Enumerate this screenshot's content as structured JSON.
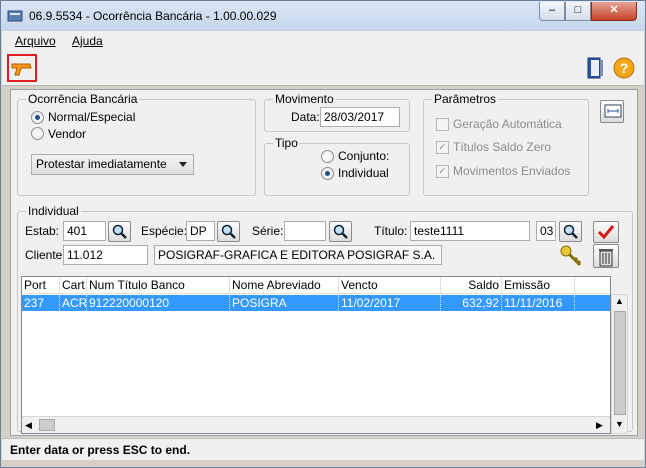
{
  "window": {
    "title": "06.9.5534 - Ocorrência Bancária - 1.00.00.029",
    "minimize": "–",
    "maximize": "□",
    "close": "✕"
  },
  "menu": [
    {
      "label": "Arquivo"
    },
    {
      "label": "Ajuda"
    }
  ],
  "ocorrencia": {
    "legend": "Ocorrência Bancária",
    "option_normal": "Normal/Especial",
    "option_vendor": "Vendor",
    "select_value": "Protestar imediatamente"
  },
  "movimento": {
    "legend": "Movimento",
    "data_label": "Data:",
    "data_value": "28/03/2017"
  },
  "tipo": {
    "legend": "Tipo",
    "option_conjunto": "Conjunto:",
    "option_individual": "Individual"
  },
  "parametros": {
    "legend": "Parâmetros",
    "geracao": "Geração Automática",
    "titulos_zero": "Títulos Saldo Zero",
    "movimentos": "Movimentos Enviados"
  },
  "individual": {
    "legend": "Individual",
    "estab_label": "Estab:",
    "estab_value": "401",
    "especie_label": "Espécie:",
    "especie_value": "DP",
    "serie_label": "Série:",
    "serie_value": "",
    "titulo_label": "Título:",
    "titulo_value": "teste1111",
    "parcela_value": "03",
    "cliente_label": "Cliente:",
    "cliente_value": "11.012",
    "cliente_nome": "POSIGRAF-GRAFICA E EDITORA POSIGRAF S.A."
  },
  "grid": {
    "columns": [
      "Port",
      "Cart",
      "Num Título Banco",
      "Nome Abreviado",
      "Vencto",
      "Saldo",
      "Emissão"
    ],
    "rows": [
      [
        "237",
        "ACR",
        "912220000120",
        "POSIGRA",
        "11/02/2017",
        "632,92",
        "11/11/2016"
      ]
    ]
  },
  "status": {
    "text": "Enter data or press ESC to end."
  }
}
